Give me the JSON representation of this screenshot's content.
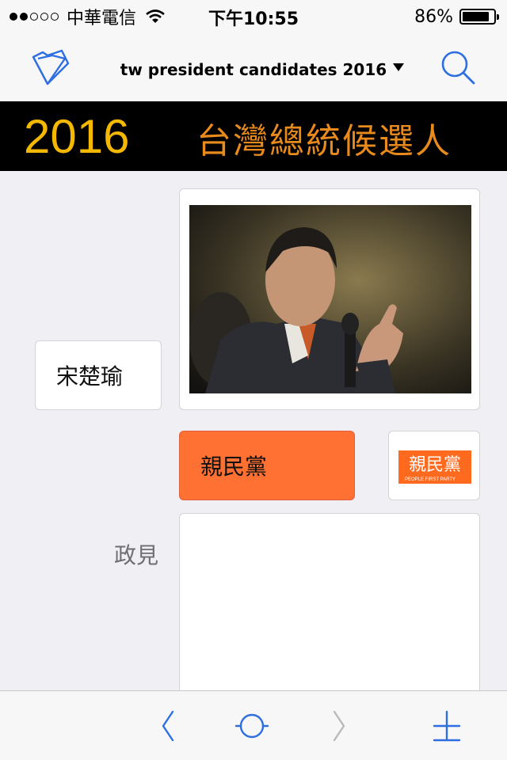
{
  "status_bar": {
    "signal_filled": 2,
    "signal_total": 5,
    "carrier": "中華電信",
    "time": "下午10:55",
    "battery_percent_text": "86%",
    "battery_level": 0.86
  },
  "nav": {
    "title": "tw president candidates 2016",
    "left_icon": "folder-icon",
    "caret_icon": "caret-down-icon",
    "right_icon": "search-icon"
  },
  "banner": {
    "year": "2016",
    "title": "台灣總統候選人"
  },
  "candidate": {
    "name": "宋楚瑜",
    "party": "親民黨",
    "party_logo_text": "親民黨",
    "party_logo_subtext": "PEOPLE FIRST PARTY",
    "policy_label": "政見",
    "policy_text": ""
  },
  "toolbar": {
    "back_icon": "chevron-left-icon",
    "home_icon": "circle-icon",
    "forward_icon": "chevron-right-icon",
    "add_icon": "plus-icon"
  },
  "colors": {
    "accent": "#2d6fe0",
    "banner_year": "#f5b800",
    "banner_title": "#e88a1c",
    "party": "#ff7033"
  }
}
